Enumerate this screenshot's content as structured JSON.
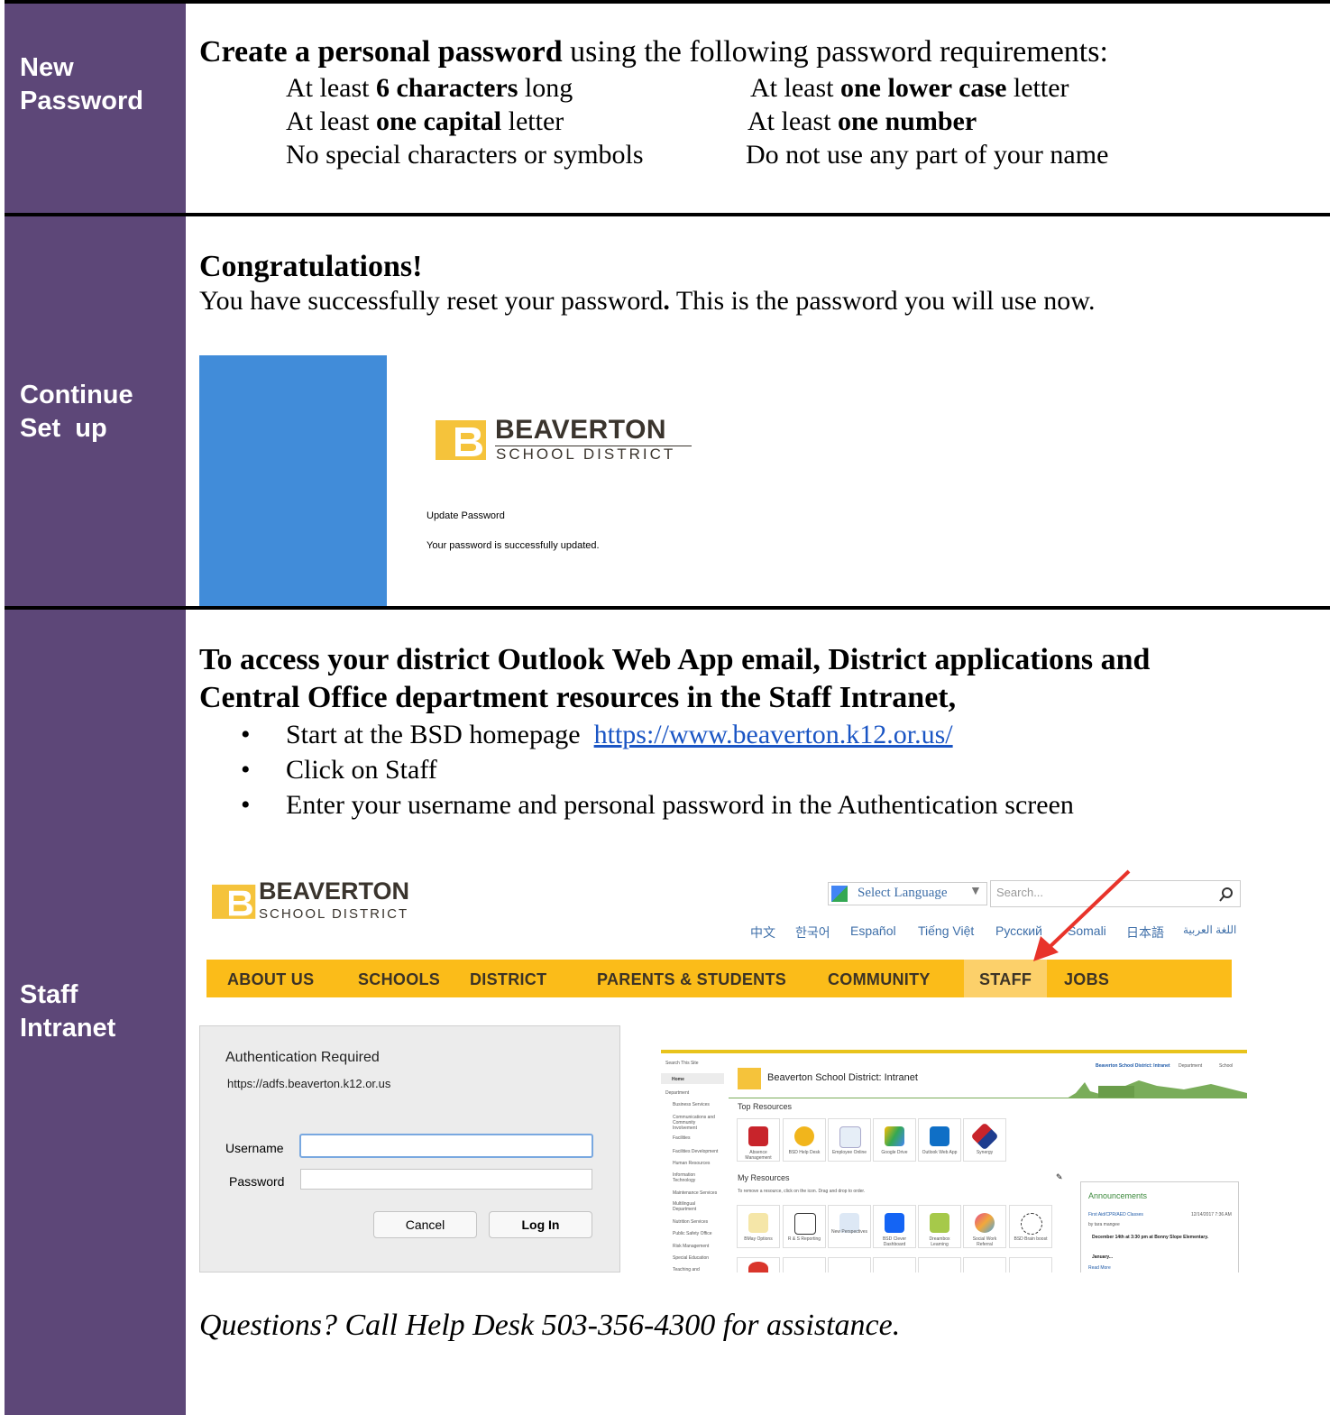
{
  "sections": {
    "new_password": {
      "label_line1": "New",
      "label_line2": "Password",
      "heading_bold": "Create a personal password",
      "heading_rest": " using the following password requirements:",
      "req1_pre": "At least ",
      "req1_bold": "6 characters",
      "req1_post": " long",
      "req2_pre": "At least ",
      "req2_bold": "one lower case",
      "req2_post": " letter",
      "req3_pre": "At least ",
      "req3_bold": "one capital",
      "req3_post": " letter",
      "req4_pre": "At least ",
      "req4_bold": "one number",
      "req5": "No special characters or symbols",
      "req6": "Do not use any part of your name"
    },
    "continue_setup": {
      "label_line1": "Continue",
      "label_line2": "Set  up",
      "heading": "Congratulations!",
      "text_pre": "You have successfully reset your password",
      "text_dot": ".",
      "text_post": " This is the password you will use now.",
      "logo_main": "BEAVERTON",
      "logo_sub": "SCHOOL DISTRICT",
      "update_title": "Update Password",
      "update_msg": "Your password is successfully updated."
    },
    "staff_intranet": {
      "label_line1": "Staff",
      "label_line2": "Intranet",
      "heading_line1": "To access your district Outlook Web App email, District applications and",
      "heading_line2": "Central Office department resources in the Staff Intranet,",
      "bullet1_text": "Start at the BSD homepage  ",
      "bullet1_link": "https://www.beaverton.k12.or.us/",
      "bullet2": "Click on Staff",
      "bullet3": "Enter your username and personal password in the Authentication screen",
      "footer": "Questions? Call Help Desk 503-356-4300 for assistance."
    }
  },
  "homepage": {
    "logo_main": "BEAVERTON",
    "logo_sub": "SCHOOL DISTRICT",
    "select_language": "Select Language",
    "search_placeholder": "Search...",
    "languages": [
      "中文",
      "한국어",
      "Español",
      "Tiếng Việt",
      "Русский",
      "Somali",
      "日本語",
      "اللغة العربية"
    ],
    "nav": [
      "ABOUT US",
      "SCHOOLS",
      "DISTRICT",
      "PARENTS & STUDENTS",
      "COMMUNITY",
      "STAFF",
      "JOBS"
    ]
  },
  "auth_dialog": {
    "title": "Authentication Required",
    "url": "https://adfs.beaverton.k12.or.us",
    "username_label": "Username",
    "password_label": "Password",
    "cancel": "Cancel",
    "login": "Log In"
  },
  "intranet": {
    "search": "Search This Site",
    "title": "Beaverton School District: Intranet",
    "top_links": "Beaverton School District: Intranet",
    "top_link2": "Department",
    "top_link3": "School",
    "top_resources": "Top Resources",
    "my_resources": "My Resources",
    "my_resources_hint": "To remove a resource, click on the  icon. Drag and drop to order.",
    "announcements": "Announcements",
    "nav": [
      "Home",
      "Department",
      "Business Services",
      "Communications and Community Involvement",
      "Facilities",
      "Facilities Development",
      "Human Resources",
      "Information Technology",
      "Maintenance Services",
      "Multilingual Department",
      "Nutrition Services",
      "Public Safety Office",
      "Risk Management",
      "Special Education",
      "Teaching and"
    ],
    "top_tiles": [
      "Absence Management",
      "BSD Help Desk",
      "Employee Online",
      "Google Drive",
      "Outlook Web App",
      "Synergy"
    ],
    "my_tiles": [
      "BMay Options",
      "R & S Reporting",
      "New Perspectives",
      "BSD Clever Dashboard",
      "Dreambox Learning",
      "Social Work Referral",
      "BSD Brain boost"
    ],
    "ann_item": "First Aid/CPR/AED Classes",
    "ann_date": "12/14/2017 7:36 AM",
    "ann_by": "by  tara mangee",
    "ann_text1": "December 14th at 3:30 pm at Bonny Slope Elementary.",
    "ann_text2": "January...",
    "ann_more": "Read More"
  },
  "colors": {
    "sidebar": "#5d4778",
    "nav_yellow": "#fbbc19",
    "logo_yellow": "#f5c33b",
    "blue_panel": "#418cd9",
    "link": "#1a55c4"
  }
}
